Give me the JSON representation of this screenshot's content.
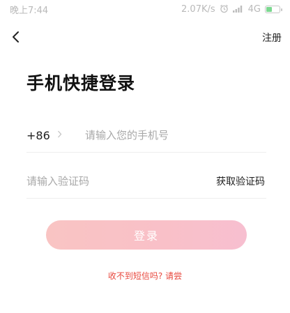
{
  "status_bar": {
    "time": "晚上7:44",
    "speed": "2.07K/s",
    "network": "4G",
    "alarm_icon": "alarm-icon",
    "signal_icon": "signal-icon",
    "battery_icon": "battery-icon"
  },
  "nav": {
    "back_icon": "back-arrow-icon",
    "register_label": "注册"
  },
  "title": "手机快捷登录",
  "phone": {
    "country_code": "+86",
    "chevron_icon": "chevron-right-icon",
    "value": "",
    "placeholder": "请输入您的手机号"
  },
  "verification": {
    "value": "",
    "placeholder": "请输入验证码",
    "get_code_label": "获取验证码"
  },
  "login_button_label": "登录",
  "help_link_label": "收不到短信吗? 请尝",
  "colors": {
    "accent": "#e8483e",
    "login_button_gradient_start": "#f9c4c3",
    "login_button_gradient_end": "#f7bfd0",
    "battery_fill": "#7bd88f"
  }
}
